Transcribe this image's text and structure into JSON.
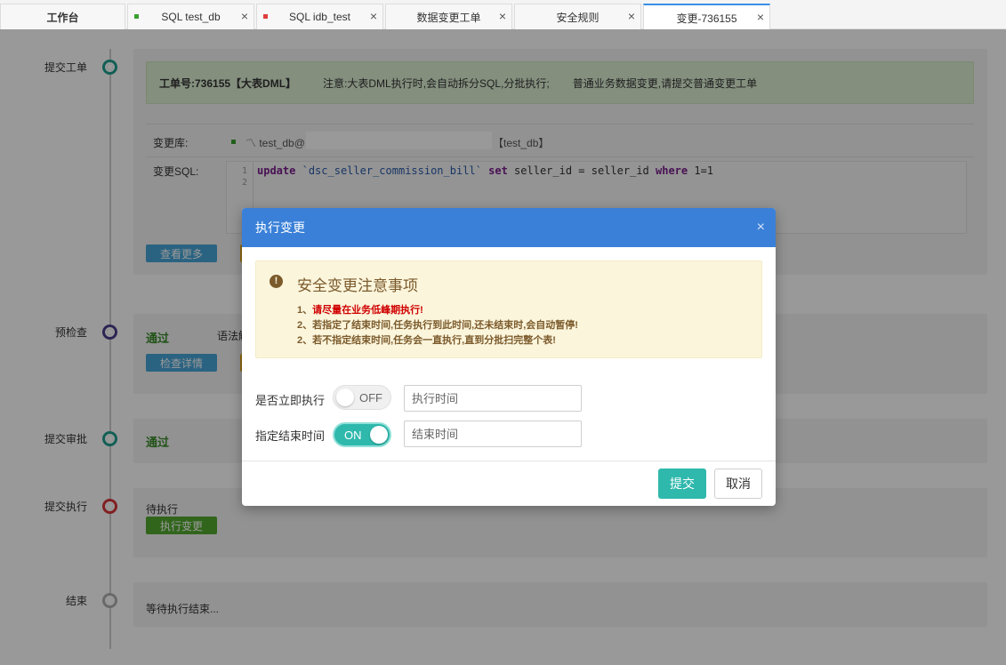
{
  "tabs": [
    {
      "label": "工作台",
      "close": ""
    },
    {
      "label": "SQL test_db",
      "close": "×",
      "dot_color": "#3aa02f"
    },
    {
      "label": "SQL idb_test",
      "close": "×",
      "dot_color": "#e03c3c"
    },
    {
      "label": "数据变更工单",
      "close": "×"
    },
    {
      "label": "安全规则",
      "close": "×"
    },
    {
      "label": "变更-736155",
      "close": "×"
    }
  ],
  "timeline": {
    "submit_order": {
      "label": "提交工单",
      "order_no": "工单号:736155【大表DML】",
      "notice_1": "注意:大表DML执行时,会自动拆分SQL,分批执行;",
      "notice_2": "普通业务数据变更,请提交普通变更工单",
      "db_label": "变更库:",
      "db_value": "〽 test_db@",
      "db_suffix": "【test_db】",
      "sql_label": "变更SQL:",
      "line_numbers": [
        "1",
        "2"
      ],
      "sql_tokens": {
        "kw_update": "update",
        "table": "`dsc_seller_commission_bill`",
        "kw_set": "set",
        "expr": "seller_id = seller_id",
        "kw_where": "where",
        "cond": "1=1"
      },
      "more_button": "查看更多"
    },
    "precheck": {
      "label": "预检查",
      "status": "通过",
      "note": "语法解",
      "detail_button": "检查详情"
    },
    "approval": {
      "label": "提交审批",
      "status": "通过"
    },
    "execute": {
      "label": "提交执行",
      "status": "待执行",
      "execute_button": "执行变更"
    },
    "end": {
      "label": "结束",
      "status": "等待执行结束..."
    }
  },
  "colors": {
    "node_submit": "#1e9e8e",
    "node_precheck": "#4a3f8c",
    "node_approval": "#1e9e8e",
    "node_execute": "#d8363a",
    "node_end": "#b0b0b0"
  },
  "modal": {
    "title": "执行变更",
    "close": "×",
    "warning": {
      "icon": "!",
      "title": "安全变更注意事项",
      "line_1_prefix": "1、",
      "line_1_text": "请尽量在业务低峰期执行!",
      "line_2": "2、若指定了结束时间,任务执行到此时间,还未结束时,会自动暂停!",
      "line_3": "2、若不指定结束时间,任务会一直执行,直到分批扫完整个表!"
    },
    "immediate": {
      "label": "是否立即执行",
      "toggle_text": "OFF",
      "state": "off",
      "input_placeholder": "执行时间"
    },
    "end_time": {
      "label": "指定结束时间",
      "toggle_text": "ON",
      "state": "on",
      "input_placeholder": "结束时间"
    },
    "submit": "提交",
    "cancel": "取消"
  }
}
